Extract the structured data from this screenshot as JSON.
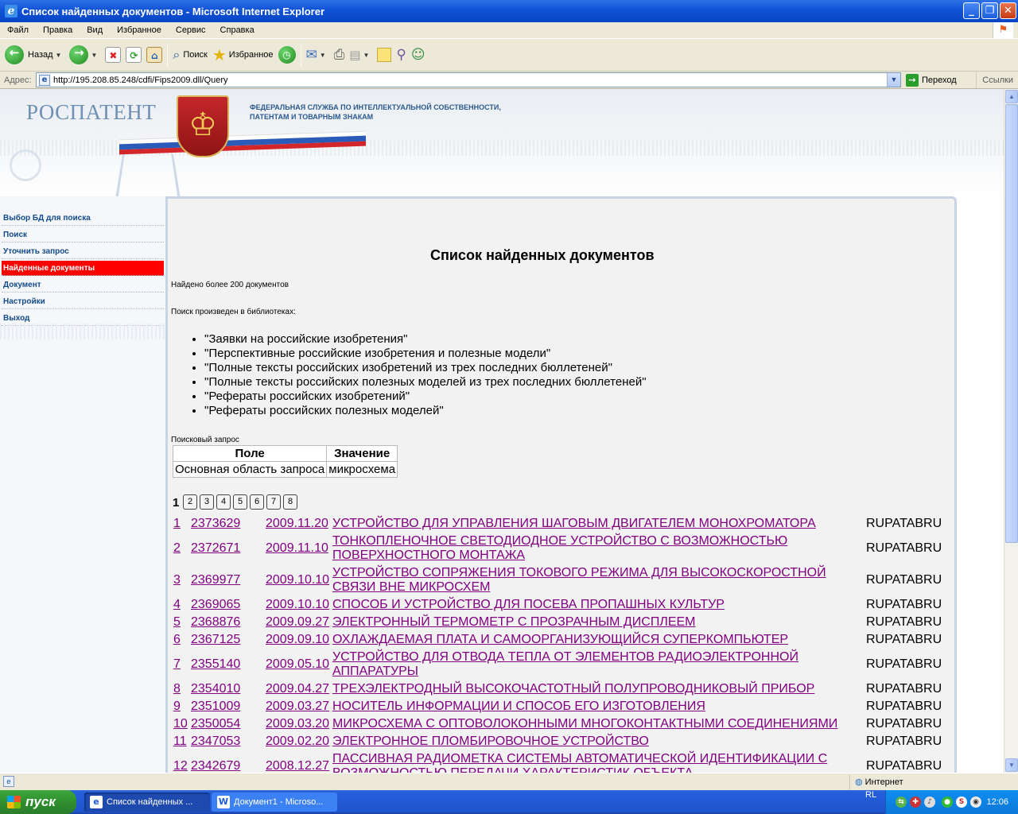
{
  "window": {
    "title": "Список найденных документов - Microsoft Internet Explorer"
  },
  "menu": [
    "Файл",
    "Правка",
    "Вид",
    "Избранное",
    "Сервис",
    "Справка"
  ],
  "toolbar": {
    "back": "Назад",
    "search": "Поиск",
    "favorites": "Избранное"
  },
  "address": {
    "label": "Адрес:",
    "url": "http://195.208.85.248/cdfi/Fips2009.dll/Query",
    "go": "Переход",
    "links": "Ссылки"
  },
  "header": {
    "logo": "РОСПАТЕНТ",
    "agency_line1": "ФЕДЕРАЛЬНАЯ СЛУЖБА ПО ИНТЕЛЛЕКТУАЛЬНОЙ СОБСТВЕННОСТИ,",
    "agency_line2": "ПАТЕНТАМ И ТОВАРНЫМ ЗНАКАМ"
  },
  "sidebar": [
    {
      "label": "Выбор БД для поиска",
      "active": false
    },
    {
      "label": "Поиск",
      "active": false
    },
    {
      "label": "Уточнить запрос",
      "active": false
    },
    {
      "label": "Найденные документы",
      "active": true
    },
    {
      "label": "Документ",
      "active": false
    },
    {
      "label": "Настройки",
      "active": false
    },
    {
      "label": "Выход",
      "active": false
    }
  ],
  "main": {
    "title": "Список найденных документов",
    "found": "Найдено более 200 документов",
    "libraries_label": "Поиск произведен в библиотеках:",
    "libraries": [
      "\"Заявки на российские изобретения\"",
      "\"Перспективные российские изобретения и полезные модели\"",
      "\"Полные тексты российских изобретений из трех последних бюллетеней\"",
      "\"Полные тексты российских полезных моделей из трех последних бюллетеней\"",
      "\"Рефераты российских изобретений\"",
      "\"Рефераты российских полезных моделей\""
    ],
    "query_label": "Поисковый запрос",
    "query_table": {
      "headers": [
        "Поле",
        "Значение"
      ],
      "rows": [
        [
          "Основная область запроса",
          "микросхема"
        ]
      ]
    },
    "pager": {
      "current": "1",
      "pages": [
        "2",
        "3",
        "4",
        "5",
        "6",
        "7",
        "8"
      ]
    },
    "results": [
      {
        "n": "1",
        "id": "2373629",
        "date": "2009.11.20",
        "title": "УСТРОЙСТВО ДЛЯ УПРАВЛЕНИЯ ШАГОВЫМ ДВИГАТЕЛЕМ МОНОХРОМАТОРА",
        "src": "RUPATABRU"
      },
      {
        "n": "2",
        "id": "2372671",
        "date": "2009.11.10",
        "title": "ТОНКОПЛЕНОЧНОЕ СВЕТОДИОДНОЕ УСТРОЙСТВО С ВОЗМОЖНОСТЬЮ ПОВЕРХНОСТНОГО МОНТАЖА",
        "src": "RUPATABRU"
      },
      {
        "n": "3",
        "id": "2369977",
        "date": "2009.10.10",
        "title": "УСТРОЙСТВО СОПРЯЖЕНИЯ ТОКОВОГО РЕЖИМА ДЛЯ ВЫСОКОСКОРОСТНОЙ СВЯЗИ ВНЕ МИКРОСХЕМ",
        "src": "RUPATABRU"
      },
      {
        "n": "4",
        "id": "2369065",
        "date": "2009.10.10",
        "title": "СПОСОБ И УСТРОЙСТВО ДЛЯ ПОСЕВА ПРОПАШНЫХ КУЛЬТУР",
        "src": "RUPATABRU"
      },
      {
        "n": "5",
        "id": "2368876",
        "date": "2009.09.27",
        "title": "ЭЛЕКТРОННЫЙ ТЕРМОМЕТР С ПРОЗРАЧНЫМ ДИСПЛЕЕМ",
        "src": "RUPATABRU"
      },
      {
        "n": "6",
        "id": "2367125",
        "date": "2009.09.10",
        "title": "ОХЛАЖДАЕМАЯ ПЛАТА И САМООРГАНИЗУЮЩИЙСЯ СУПЕРКОМПЬЮТЕР",
        "src": "RUPATABRU"
      },
      {
        "n": "7",
        "id": "2355140",
        "date": "2009.05.10",
        "title": "УСТРОЙСТВО ДЛЯ ОТВОДА ТЕПЛА ОТ ЭЛЕМЕНТОВ РАДИОЭЛЕКТРОННОЙ АППАРАТУРЫ",
        "src": "RUPATABRU"
      },
      {
        "n": "8",
        "id": "2354010",
        "date": "2009.04.27",
        "title": "ТРЕХЭЛЕКТРОДНЫЙ ВЫСОКОЧАСТОТНЫЙ ПОЛУПРОВОДНИКОВЫЙ ПРИБОР",
        "src": "RUPATABRU"
      },
      {
        "n": "9",
        "id": "2351009",
        "date": "2009.03.27",
        "title": "НОСИТЕЛЬ ИНФОРМАЦИИ И СПОСОБ ЕГО ИЗГОТОВЛЕНИЯ",
        "src": "RUPATABRU"
      },
      {
        "n": "10",
        "id": "2350054",
        "date": "2009.03.20",
        "title": "МИКРОСХЕМА С ОПТОВОЛОКОННЫМИ МНОГОКОНТАКТНЫМИ СОЕДИНЕНИЯМИ",
        "src": "RUPATABRU"
      },
      {
        "n": "11",
        "id": "2347053",
        "date": "2009.02.20",
        "title": "ЭЛЕКТРОННОЕ ПЛОМБИРОВОЧНОЕ УСТРОЙСТВО",
        "src": "RUPATABRU"
      },
      {
        "n": "12",
        "id": "2342679",
        "date": "2008.12.27",
        "title": "ПАССИВНАЯ РАДИОМЕТКА СИСТЕМЫ АВТОМАТИЧЕСКОЙ ИДЕНТИФИКАЦИИ С ВОЗМОЖНОСТЬЮ ПЕРЕДАЧИ ХАРАКТЕРИСТИК ОБЪЕКТА",
        "src": "RUPATABRU"
      }
    ]
  },
  "status": {
    "zone": "Интернет"
  },
  "taskbar": {
    "start": "пуск",
    "tasks": [
      "Список найденных ...",
      "Документ1 - Microso..."
    ],
    "lang": "RL",
    "clock": "12:06"
  },
  "colors": {
    "active_nav": "#ff0000",
    "visited_link": "#800080",
    "titlebar": "#0a45c6"
  }
}
